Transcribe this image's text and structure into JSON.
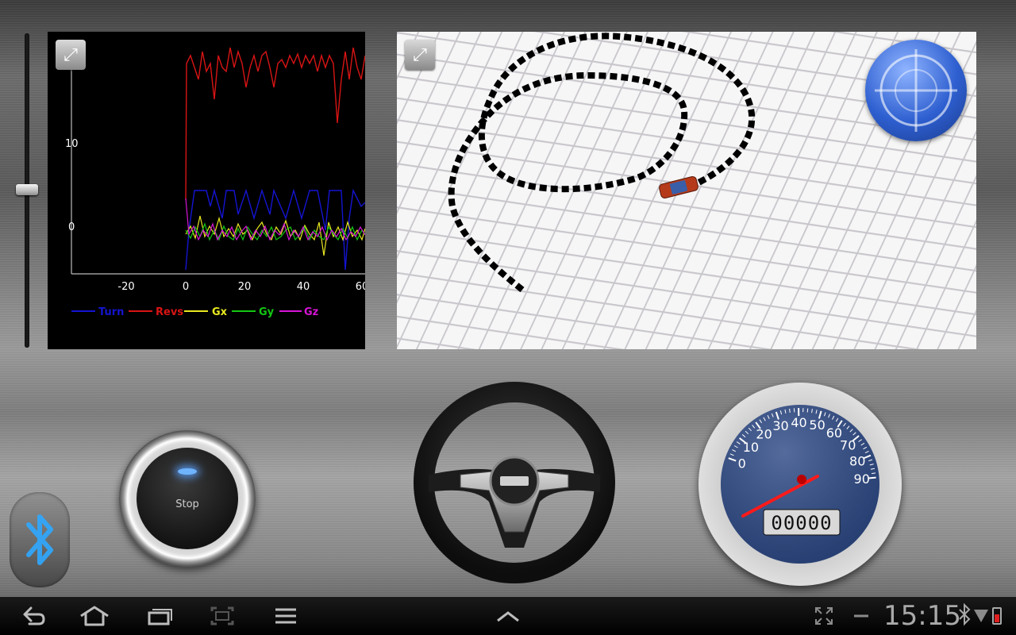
{
  "graph": {
    "x_ticks": [
      "-20",
      "0",
      "20",
      "40",
      "60"
    ],
    "y_ticks": [
      "10",
      "0"
    ],
    "legend": [
      {
        "name": "Turn",
        "color": "#1414d2"
      },
      {
        "name": "Revs",
        "color": "#d81414"
      },
      {
        "name": "Gx",
        "color": "#e8e820"
      },
      {
        "name": "Gy",
        "color": "#14c814"
      },
      {
        "name": "Gz",
        "color": "#d614d6"
      }
    ]
  },
  "controls": {
    "stop_label": "Stop",
    "bluetooth_icon": "bluetooth-icon",
    "expand_icon": "expand-icon",
    "compass_icon": "compass-icon"
  },
  "speedometer": {
    "scale": [
      "0",
      "10",
      "20",
      "30",
      "40",
      "50",
      "60",
      "70",
      "80",
      "90"
    ],
    "odometer": "00000",
    "speed_value": 0
  },
  "statusbar": {
    "clock": "15:15"
  },
  "colors": {
    "map_bg": "#f4f4f4",
    "gauge_face": "#2e4a86",
    "needle": "#ff1a1a"
  }
}
